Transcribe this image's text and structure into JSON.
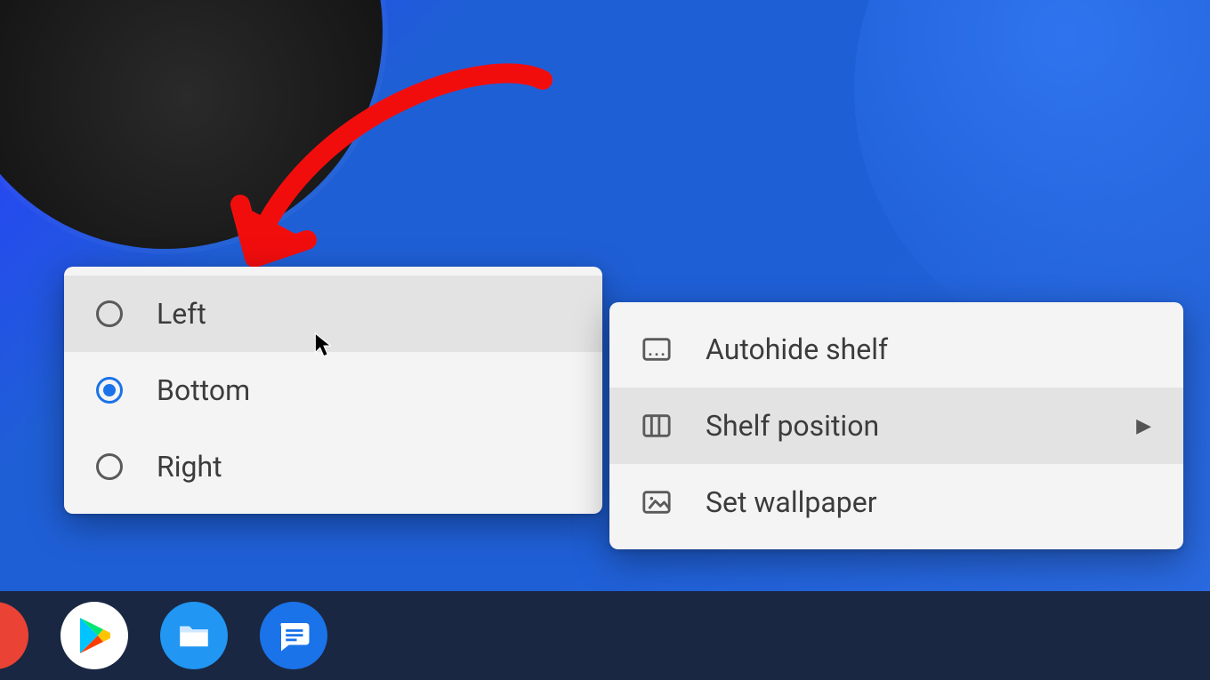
{
  "submenu": {
    "options": [
      {
        "label": "Left",
        "selected": false,
        "hovered": true
      },
      {
        "label": "Bottom",
        "selected": true,
        "hovered": false
      },
      {
        "label": "Right",
        "selected": false,
        "hovered": false
      }
    ]
  },
  "mainmenu": {
    "items": [
      {
        "label": "Autohide shelf",
        "icon": "autohide-icon",
        "has_submenu": false,
        "hovered": false
      },
      {
        "label": "Shelf position",
        "icon": "layout-icon",
        "has_submenu": true,
        "hovered": true
      },
      {
        "label": "Set wallpaper",
        "icon": "picture-icon",
        "has_submenu": false,
        "hovered": false
      }
    ]
  },
  "shelf": {
    "apps": [
      "youtube",
      "play-store",
      "files",
      "messages"
    ]
  },
  "annotation": {
    "arrow_color": "#f20d0d"
  }
}
